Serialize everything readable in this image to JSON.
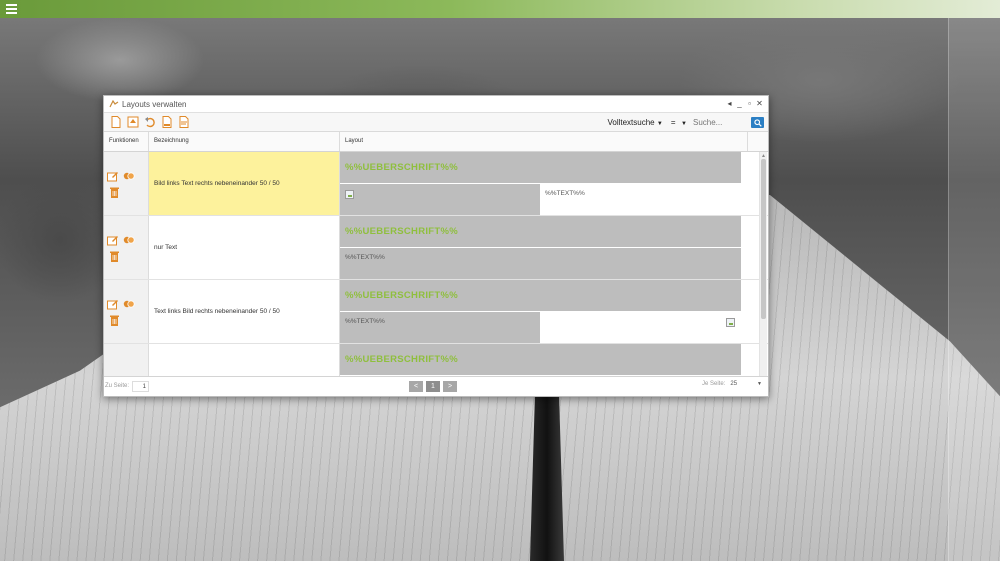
{
  "window": {
    "title": "Layouts verwalten"
  },
  "toolbar": {
    "search_mode": "Volltextsuche",
    "operator": "=",
    "search_placeholder": "Suche...",
    "icons": [
      "new-document-icon",
      "upload-icon",
      "undo-icon",
      "export-pdf-icon",
      "export-document-icon"
    ]
  },
  "grid": {
    "headers": {
      "functions": "Funktionen",
      "name": "Bezeichnung",
      "layout": "Layout"
    },
    "rows": [
      {
        "name": "Bild links Text rechts nebeneinander 50 / 50",
        "heading": "%%UEBERSCHRIFT%%",
        "text": "%%TEXT%%"
      },
      {
        "name": "nur Text",
        "heading": "%%UEBERSCHRIFT%%",
        "text": "%%TEXT%%"
      },
      {
        "name": "Text links Bild rechts nebeneinander 50 / 50",
        "heading": "%%UEBERSCHRIFT%%",
        "text": "%%TEXT%%"
      },
      {
        "name": "",
        "heading": "%%UEBERSCHRIFT%%",
        "text": ""
      }
    ]
  },
  "footer": {
    "page_label": "Zu Seite:",
    "page_value": "1",
    "prev": "<",
    "current": "1",
    "next": ">",
    "per_page_label": "Je Seite:",
    "per_page_value": "25"
  },
  "colors": {
    "accent_green": "#8fbf3d",
    "selected_row": "#fdf29c",
    "search_button": "#2b7fc4",
    "layout_gray": "#bdbdbd"
  }
}
